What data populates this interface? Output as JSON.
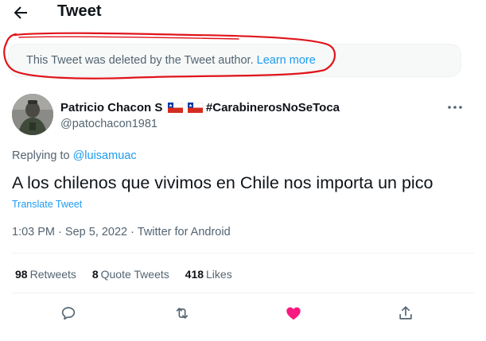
{
  "header": {
    "title": "Tweet"
  },
  "notice": {
    "text": "This Tweet was deleted by the Tweet author.",
    "link": "Learn more"
  },
  "author": {
    "display_name": "Patricio Chacon S",
    "hashtag": "#CarabinerosNoSeToca",
    "username": "@patochacon1981"
  },
  "reply": {
    "prefix": "Replying to",
    "to": "@luisamuac"
  },
  "tweet": {
    "text": "A los chilenos que vivimos en Chile nos importa un pico",
    "translate": "Translate Tweet",
    "time": "1:03 PM",
    "date": "Sep 5, 2022",
    "source": "Twitter for Android"
  },
  "stats": {
    "retweets_count": "98",
    "retweets_label": "Retweets",
    "quotes_count": "8",
    "quotes_label": "Quote Tweets",
    "likes_count": "418",
    "likes_label": "Likes"
  },
  "colors": {
    "accent": "#1d9bf0",
    "like": "#f91880",
    "muted": "#536471",
    "annotation": "#e0141b"
  },
  "icons": {
    "back": "arrow-left-icon",
    "more": "more-horizontal-icon",
    "reply": "comment-icon",
    "retweet": "retweet-icon",
    "like": "heart-filled-icon",
    "share": "share-icon"
  }
}
